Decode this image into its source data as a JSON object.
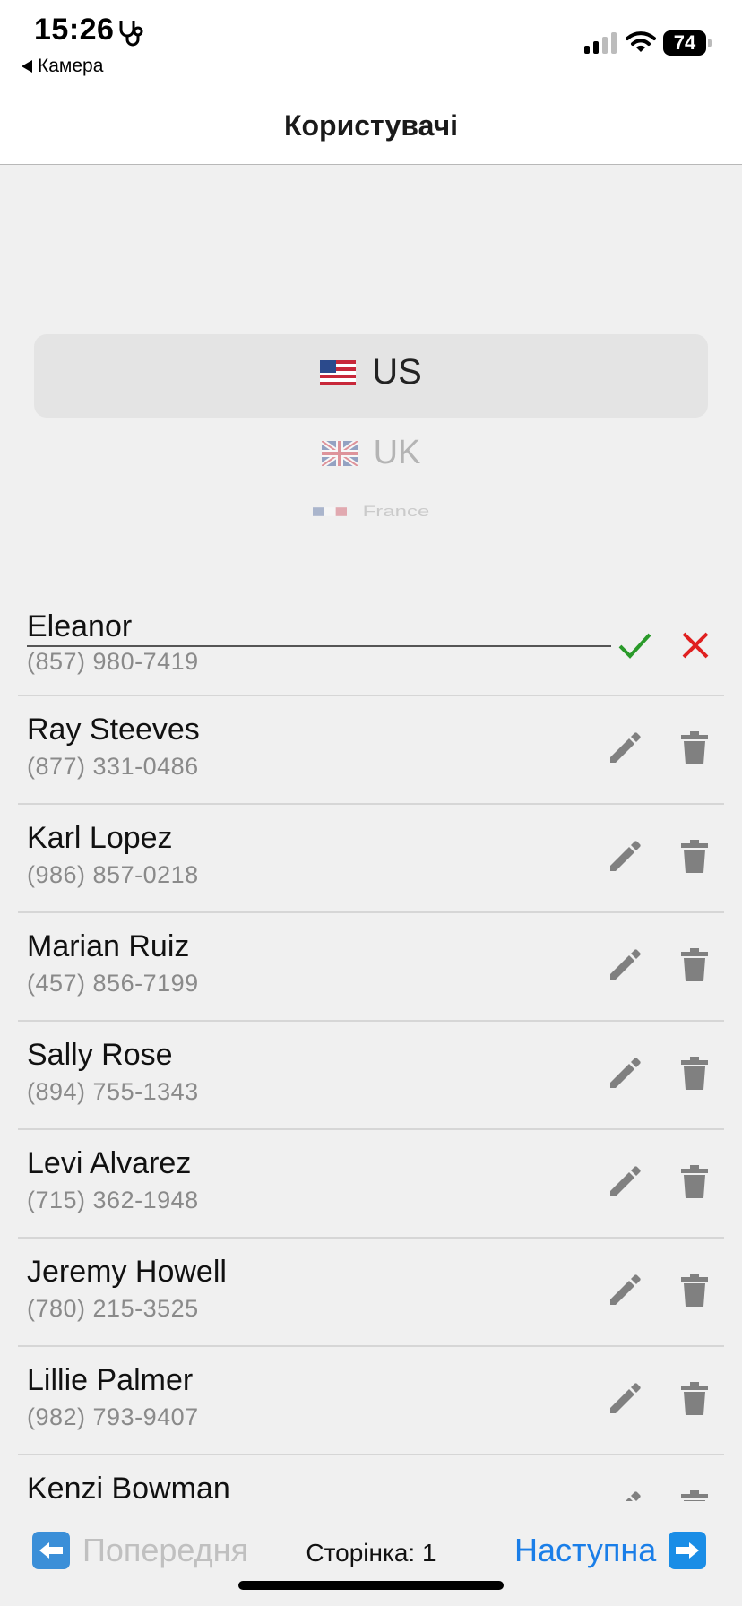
{
  "status_bar": {
    "time": "15:26",
    "back_app": "Камера",
    "battery": "74"
  },
  "nav": {
    "title": "Користувачі"
  },
  "country_picker": {
    "options": [
      {
        "label": "US",
        "flag": "us-flag-icon"
      },
      {
        "label": "UK",
        "flag": "uk-flag-icon"
      },
      {
        "label": "France",
        "flag": "france-flag-icon"
      }
    ],
    "selected": "US"
  },
  "users": {
    "editing": {
      "value": "Eleanor",
      "phone": "(857) 980-7419"
    },
    "items": [
      {
        "name": "Ray Steeves",
        "phone": "(877) 331-0486"
      },
      {
        "name": "Karl Lopez",
        "phone": "(986) 857-0218"
      },
      {
        "name": "Marian Ruiz",
        "phone": "(457) 856-7199"
      },
      {
        "name": "Sally Rose",
        "phone": "(894) 755-1343"
      },
      {
        "name": "Levi Alvarez",
        "phone": "(715) 362-1948"
      },
      {
        "name": "Jeremy Howell",
        "phone": "(780) 215-3525"
      },
      {
        "name": "Lillie Palmer",
        "phone": "(982) 793-9407"
      },
      {
        "name": "Kenzi Bowman",
        "phone": ""
      }
    ]
  },
  "pagination": {
    "prev_label": "Попередня",
    "page_label": "Сторінка: 1",
    "next_label": "Наступна"
  },
  "colors": {
    "accent": "#1a7ee8",
    "confirm": "#2a9a2a",
    "cancel": "#e02020",
    "icon_gray": "#808080"
  }
}
